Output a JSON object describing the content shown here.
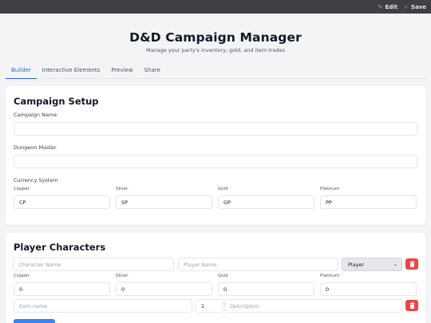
{
  "topbar": {
    "edit_label": "Edit",
    "save_label": "Save"
  },
  "header": {
    "title": "D&D Campaign Manager",
    "subtitle": "Manage your party's inventory, gold, and item trades"
  },
  "tabs": [
    {
      "label": "Builder",
      "active": true
    },
    {
      "label": "Interactive Elements"
    },
    {
      "label": "Preview"
    },
    {
      "label": "Share"
    }
  ],
  "campaign": {
    "title": "Campaign Setup",
    "name_label": "Campaign Name",
    "name_value": "",
    "dm_label": "Dungeon Master",
    "dm_value": "",
    "currency_label": "Currency System",
    "currencies": [
      {
        "label": "Copper",
        "value": "CP"
      },
      {
        "label": "Silver",
        "value": "SP"
      },
      {
        "label": "Gold",
        "value": "GP"
      },
      {
        "label": "Platinum",
        "value": "PP"
      }
    ]
  },
  "players": {
    "title": "Player Characters",
    "character_placeholder": "Character Name",
    "player_placeholder": "Player Name",
    "role_selected": "Player",
    "coins": [
      {
        "label": "Copper",
        "value": "0"
      },
      {
        "label": "Silver",
        "value": "0"
      },
      {
        "label": "Gold",
        "value": "0"
      },
      {
        "label": "Platinum",
        "value": "0"
      }
    ],
    "item_placeholder": "Item name",
    "item_quantity": "1",
    "description_placeholder": "Description"
  },
  "colors": {
    "accent": "#2563eb",
    "danger": "#ef4444",
    "topbar": "#3f3f46"
  },
  "icons": {
    "edit": "pencil-icon",
    "save": "check-icon",
    "delete": "trash-icon",
    "select": "chevron-down-icon"
  }
}
